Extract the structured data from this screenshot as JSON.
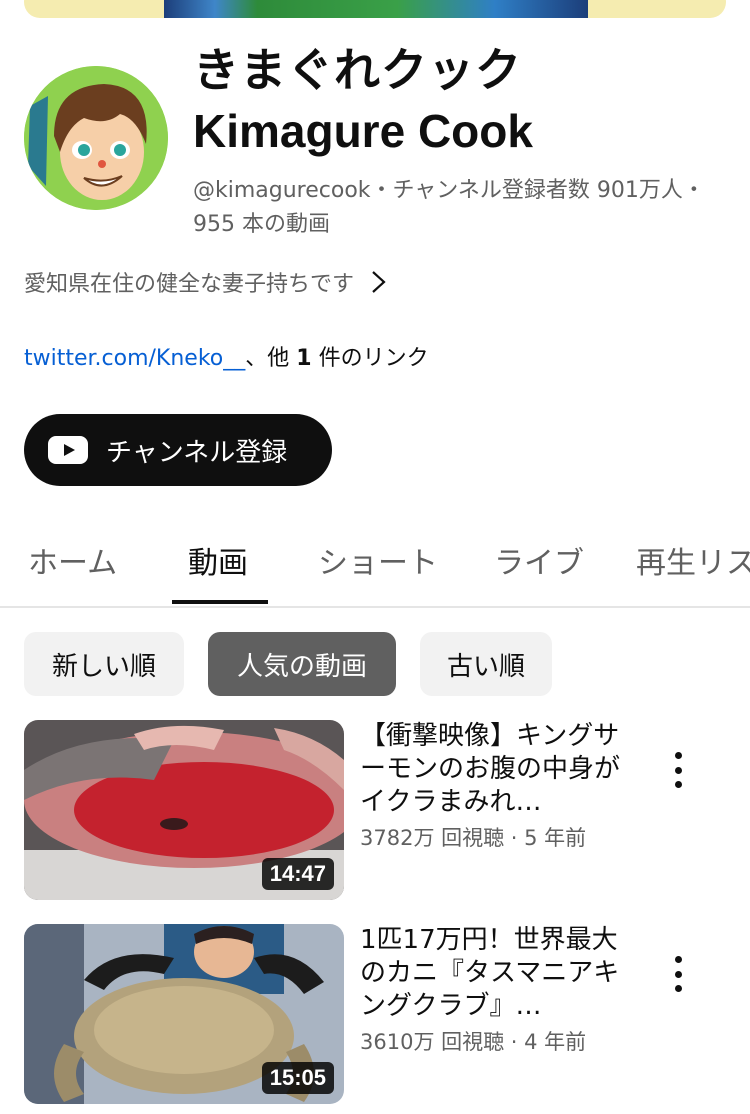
{
  "channel": {
    "title": "きまぐれクック",
    "title_en": "Kimagure Cook",
    "meta_line": "@kimagurecook・チャンネル登録者数 901万人・955 本の動画",
    "description": "愛知県在住の健全な妻子持ちです",
    "link_url": "twitter.com/Kneko__",
    "link_rest_prefix": "、他 ",
    "link_rest_count": "1",
    "link_rest_suffix": " 件のリンク",
    "subscribe_label": "チャンネル登録"
  },
  "tabs": [
    {
      "label": "ホーム"
    },
    {
      "label": "動画"
    },
    {
      "label": "ショート"
    },
    {
      "label": "ライブ"
    },
    {
      "label": "再生リスト"
    }
  ],
  "active_tab": "動画",
  "chips": [
    {
      "label": "新しい順"
    },
    {
      "label": "人気の動画"
    },
    {
      "label": "古い順"
    }
  ],
  "active_chip": "人気の動画",
  "videos": [
    {
      "title": "【衝撃映像】キングサーモンのお腹の中身がイクラまみれ…",
      "meta": "3782万 回視聴 · 5 年前",
      "duration": "14:47"
    },
    {
      "title": "1匹17万円！世界最大のカニ『タスマニアキングクラブ』…",
      "meta": "3610万 回視聴 · 4 年前",
      "duration": "15:05"
    }
  ],
  "icons": {
    "subscribe": "youtube-play-icon",
    "description_more": "chevron-right-icon",
    "video_menu": "more-vertical-icon"
  },
  "colors": {
    "link": "#065fd4",
    "subscribe_bg": "#0f0f0f",
    "chip_active": "#606060",
    "chip_default": "#f2f2f2",
    "muted_text": "#606060"
  }
}
